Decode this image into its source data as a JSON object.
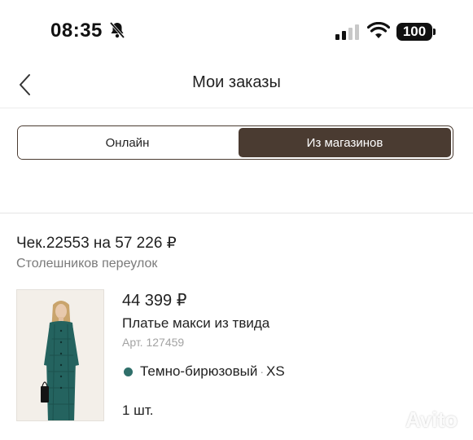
{
  "status_bar": {
    "time": "08:35",
    "battery": "100"
  },
  "header": {
    "title": "Мои заказы"
  },
  "tabs": [
    {
      "label": "Онлайн",
      "selected": false
    },
    {
      "label": "Из магазинов",
      "selected": true
    }
  ],
  "receipt": {
    "title": "Чек.22553 на 57 226 ₽",
    "address": "Столешников переулок"
  },
  "product": {
    "price": "44 399 ₽",
    "name": "Платье макси из твида",
    "article": "Арт. 127459",
    "color": "Темно-бирюзовый",
    "separator": "·",
    "size": "XS",
    "quantity": "1 шт.",
    "color_hex": "#2f6f6a"
  },
  "watermark": "Avito",
  "colors": {
    "accent": "#4a3b31"
  }
}
